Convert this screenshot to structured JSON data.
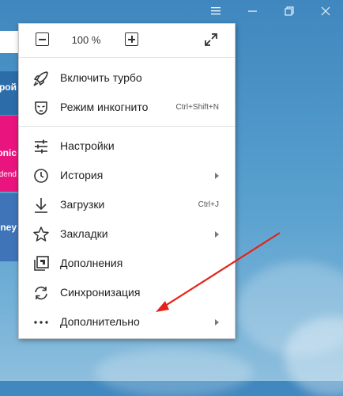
{
  "titlebar": {
    "menu_icon": "hamburger-icon",
    "minimize_icon": "minimize-icon",
    "restore_icon": "restore-icon",
    "close_icon": "close-icon"
  },
  "background_tiles": [
    {
      "text": "трой",
      "color": "#2c6da9"
    },
    {
      "text": "onic",
      "color": "#ea147f"
    },
    {
      "text": "dend",
      "color": "#ea147f"
    },
    {
      "text": "ney",
      "color": "#3f74b8"
    }
  ],
  "menu": {
    "zoom": {
      "value": "100 %",
      "minus_icon": "zoom-out-icon",
      "plus_icon": "zoom-in-icon",
      "fullscreen_icon": "fullscreen-icon"
    },
    "items": [
      {
        "label": "Включить турбо",
        "icon": "rocket-icon",
        "shortcut": "",
        "submenu": false
      },
      {
        "label": "Режим инкогнито",
        "icon": "incognito-mask-icon",
        "shortcut": "Ctrl+Shift+N",
        "submenu": false
      },
      {
        "label": "Настройки",
        "icon": "settings-sliders-icon",
        "shortcut": "",
        "submenu": false
      },
      {
        "label": "История",
        "icon": "history-clock-icon",
        "shortcut": "",
        "submenu": true
      },
      {
        "label": "Загрузки",
        "icon": "download-icon",
        "shortcut": "Ctrl+J",
        "submenu": false
      },
      {
        "label": "Закладки",
        "icon": "star-icon",
        "shortcut": "",
        "submenu": true
      },
      {
        "label": "Дополнения",
        "icon": "extensions-icon",
        "shortcut": "",
        "submenu": false
      },
      {
        "label": "Синхронизация",
        "icon": "sync-icon",
        "shortcut": "",
        "submenu": false
      },
      {
        "label": "Дополнительно",
        "icon": "more-dots-icon",
        "shortcut": "",
        "submenu": true
      }
    ]
  },
  "annotation": {
    "arrow_color": "#e32219"
  }
}
